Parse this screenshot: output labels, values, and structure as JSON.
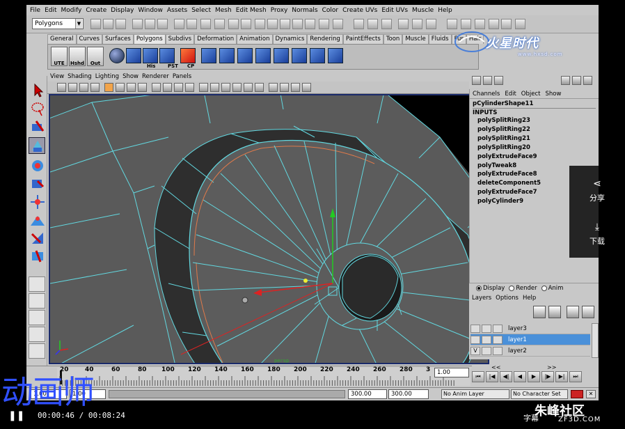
{
  "menu": [
    "File",
    "Edit",
    "Modify",
    "Create",
    "Display",
    "Window",
    "Assets",
    "Select",
    "Mesh",
    "Edit Mesh",
    "Proxy",
    "Normals",
    "Color",
    "Create UVs",
    "Edit UVs",
    "Muscle",
    "Help"
  ],
  "status_line": {
    "mode": "Polygons"
  },
  "shelf": {
    "tabs": [
      "General",
      "Curves",
      "Surfaces",
      "Polygons",
      "Subdivs",
      "Deformation",
      "Animation",
      "Dynamics",
      "Rendering",
      "PaintEffects",
      "Toon",
      "Muscle",
      "Fluids",
      "Fur",
      "Hair"
    ],
    "active_tab": "Polygons",
    "buttons": [
      "UTE",
      "Hshd",
      "Out",
      "His",
      "PST",
      "CP"
    ]
  },
  "logo": {
    "text": "火星时代",
    "url": "www.hxsd.com"
  },
  "viewport": {
    "menu": [
      "View",
      "Shading",
      "Lighting",
      "Show",
      "Renderer",
      "Panels"
    ],
    "camera_label": "persp"
  },
  "channel_box": {
    "menu": [
      "Channels",
      "Edit",
      "Object",
      "Show"
    ],
    "shape": "pCylinderShape11",
    "inputs_label": "INPUTS",
    "nodes": [
      "polySplitRing23",
      "polySplitRing22",
      "polySplitRing21",
      "polySplitRing20",
      "polyExtrudeFace9",
      "polyTweak8",
      "polyExtrudeFace8",
      "deleteComponent5",
      "polyExtrudeFace7",
      "polyCylinder9"
    ]
  },
  "layer_editor": {
    "modes": [
      "Display",
      "Render",
      "Anim"
    ],
    "active_mode": "Display",
    "menu": [
      "Layers",
      "Options",
      "Help"
    ],
    "layers": [
      {
        "name": "layer3",
        "visible": "",
        "selected": false
      },
      {
        "name": "layer1",
        "visible": "",
        "selected": true
      },
      {
        "name": "layer2",
        "visible": "V",
        "selected": false
      }
    ]
  },
  "time_slider": {
    "ticks": [
      "20",
      "40",
      "60",
      "80",
      "100",
      "120",
      "140",
      "160",
      "180",
      "200",
      "220",
      "240",
      "260",
      "280",
      "3"
    ],
    "current_frame": "1.00"
  },
  "range_slider": {
    "start": "1.00",
    "range_start": "1.00",
    "range_end": "300.00",
    "end": "300.00",
    "anim_layer": "No Anim Layer",
    "character_set": "No Character Set"
  },
  "share_panel": {
    "share": "分享",
    "download": "下载"
  },
  "video_bar": {
    "watermark": "动画师",
    "timecode": "00:00:46 / 00:08:24",
    "subtitle_label": "字幕",
    "site": "朱峰社区",
    "site_url": "ZF3D.COM"
  },
  "colors": {
    "viewport_bg": "#4e4e4e",
    "wireframe": "#62d8e0",
    "selection": "#4a90d9",
    "watermark": "#3050ff"
  }
}
